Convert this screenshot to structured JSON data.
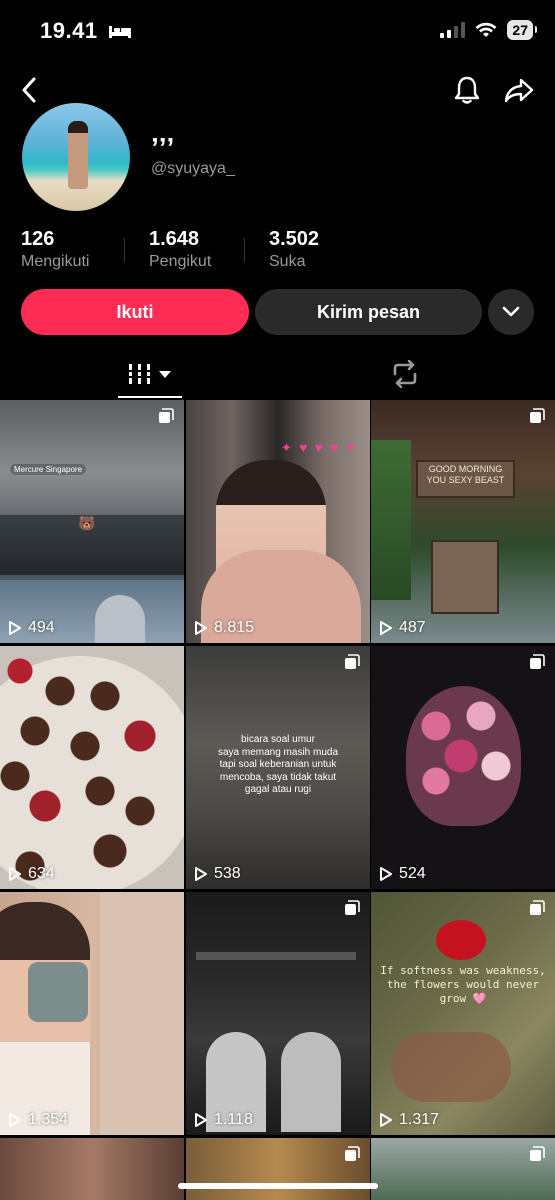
{
  "status_bar": {
    "time": "19.41",
    "battery": "27"
  },
  "profile": {
    "display_name": "’’’",
    "username": "@syuyaya_"
  },
  "stats": [
    {
      "value": "126",
      "label": "Mengikuti"
    },
    {
      "value": "1.648",
      "label": "Pengikut"
    },
    {
      "value": "3.502",
      "label": "Suka"
    }
  ],
  "actions": {
    "follow": "Ikuti",
    "message": "Kirim pesan"
  },
  "tiles": [
    {
      "views": "494",
      "caption": ""
    },
    {
      "views": "8.815",
      "caption": ""
    },
    {
      "views": "487",
      "caption": ""
    },
    {
      "views": "634",
      "caption": ""
    },
    {
      "views": "538",
      "caption": "bicara soal umur\nsaya memang masih muda\ntapi soal keberanian untuk\nmencoba, saya tidak takut\ngagal atau rugi"
    },
    {
      "views": "524",
      "caption": ""
    },
    {
      "views": "1.354",
      "caption": ""
    },
    {
      "views": "1.118",
      "caption": ""
    },
    {
      "views": "1.317",
      "caption": "If softness was weakness,\nthe flowers would never\ngrow 🩷"
    }
  ],
  "tile3_sign": "GOOD MORNING\nYOU SEXY BEAST",
  "tile1_location": "Mercure Singapore"
}
